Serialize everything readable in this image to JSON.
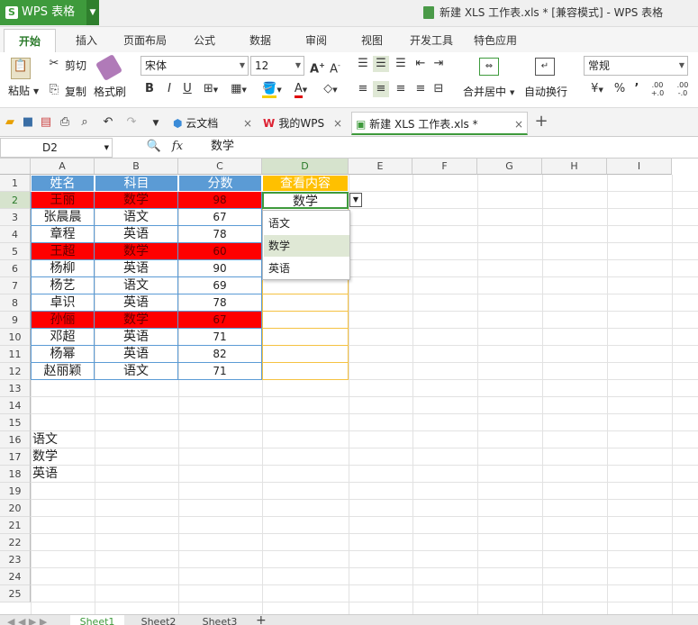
{
  "app": {
    "logo_label": "WPS 表格",
    "title": "新建 XLS 工作表.xls * [兼容模式] - WPS 表格"
  },
  "ribbon_tabs": [
    "开始",
    "插入",
    "页面布局",
    "公式",
    "数据",
    "审阅",
    "视图",
    "开发工具",
    "特色应用"
  ],
  "ribbon": {
    "paste": "粘贴",
    "cut": "剪切",
    "copy": "复制",
    "format_painter": "格式刷",
    "font_name": "宋体",
    "font_size": "12",
    "bold": "B",
    "italic": "I",
    "underline": "U",
    "merge_center": "合并居中",
    "wrap_text": "自动换行",
    "number_format": "常规",
    "percent": "%",
    "comma": "’",
    "inc_decimal": ".00 +.0",
    "dec_decimal": ".00 -.0"
  },
  "doc_tabs": [
    "云文档",
    "我的WPS",
    "新建 XLS 工作表.xls *"
  ],
  "formula_bar": {
    "cell_ref": "D2",
    "fx": "fx",
    "content": "数学"
  },
  "columns": [
    "A",
    "B",
    "C",
    "D",
    "E",
    "F",
    "G",
    "H",
    "I"
  ],
  "rows": [
    "1",
    "2",
    "3",
    "4",
    "5",
    "6",
    "7",
    "8",
    "9",
    "10",
    "11",
    "12",
    "13",
    "14",
    "15",
    "16",
    "17",
    "18",
    "19",
    "20",
    "21",
    "22",
    "23",
    "24",
    "25"
  ],
  "table": {
    "headers": [
      "姓名",
      "科目",
      "分数",
      "查看内容"
    ],
    "data": [
      [
        "王丽",
        "数学",
        "98"
      ],
      [
        "张晨晨",
        "语文",
        "67"
      ],
      [
        "章程",
        "英语",
        "78"
      ],
      [
        "王超",
        "数学",
        "60"
      ],
      [
        "杨柳",
        "英语",
        "90"
      ],
      [
        "杨艺",
        "语文",
        "69"
      ],
      [
        "卓识",
        "英语",
        "78"
      ],
      [
        "孙俪",
        "数学",
        "67"
      ],
      [
        "邓超",
        "英语",
        "71"
      ],
      [
        "杨幂",
        "英语",
        "82"
      ],
      [
        "赵丽颖",
        "语文",
        "71"
      ]
    ],
    "highlighted_rows": [
      0,
      3,
      7
    ],
    "d2_value": "数学"
  },
  "list_cells": [
    "语文",
    "数学",
    "英语"
  ],
  "dropdown": {
    "options": [
      "语文",
      "数学",
      "英语"
    ],
    "selected_index": 1
  },
  "sheets": [
    "Sheet1",
    "Sheet2",
    "Sheet3"
  ],
  "colors": {
    "header_blue": "#5b9bd5",
    "highlight_red": "#ff0000",
    "header_gold": "#ffc000",
    "wps_green": "#3e9a3c"
  }
}
